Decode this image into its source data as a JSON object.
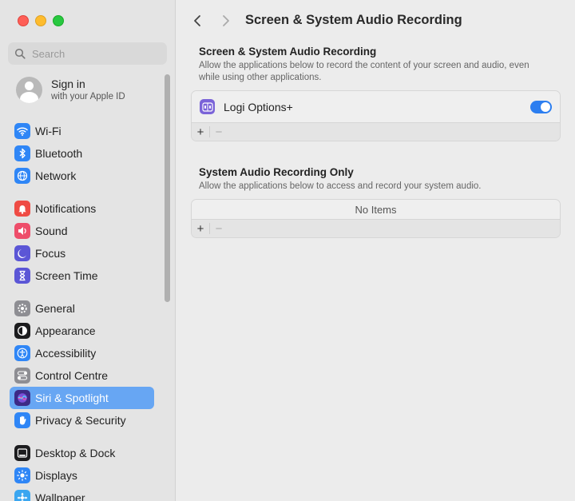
{
  "window": {
    "title": "Screen & System Audio Recording"
  },
  "sidebar": {
    "search_placeholder": "Search",
    "account": {
      "title": "Sign in",
      "subtitle": "with your Apple ID"
    },
    "groups": [
      [
        {
          "label": "Wi-Fi",
          "icon": "wifi-icon",
          "color": "#2f86f6"
        },
        {
          "label": "Bluetooth",
          "icon": "bluetooth-icon",
          "color": "#2f86f6"
        },
        {
          "label": "Network",
          "icon": "globe-icon",
          "color": "#2f86f6"
        }
      ],
      [
        {
          "label": "Notifications",
          "icon": "bell-icon",
          "color": "#ef4b44"
        },
        {
          "label": "Sound",
          "icon": "speaker-icon",
          "color": "#ee4d6a"
        },
        {
          "label": "Focus",
          "icon": "moon-icon",
          "color": "#5b56d6"
        },
        {
          "label": "Screen Time",
          "icon": "hourglass-icon",
          "color": "#5b56d6"
        }
      ],
      [
        {
          "label": "General",
          "icon": "gear-icon",
          "color": "#8e8e93"
        },
        {
          "label": "Appearance",
          "icon": "appearance-icon",
          "color": "#1c1c1e"
        },
        {
          "label": "Accessibility",
          "icon": "accessibility-icon",
          "color": "#2f86f6"
        },
        {
          "label": "Control Centre",
          "icon": "toggles-icon",
          "color": "#8e8e93"
        },
        {
          "label": "Siri & Spotlight",
          "icon": "siri-icon",
          "color": "#3c2a86",
          "active": true
        },
        {
          "label": "Privacy & Security",
          "icon": "hand-icon",
          "color": "#2f86f6"
        }
      ],
      [
        {
          "label": "Desktop & Dock",
          "icon": "dock-icon",
          "color": "#1c1c1e"
        },
        {
          "label": "Displays",
          "icon": "sun-icon",
          "color": "#2f86f6"
        },
        {
          "label": "Wallpaper",
          "icon": "wallpaper-icon",
          "color": "#3aa6f0"
        }
      ]
    ]
  },
  "toolbar": {
    "title": "Screen & System Audio Recording"
  },
  "sections": {
    "screen": {
      "title": "Screen & System Audio Recording",
      "description": "Allow the applications below to record the content of your screen and audio, even while using other applications.",
      "apps": [
        {
          "name": "Logi Options+",
          "enabled": true
        }
      ]
    },
    "audio": {
      "title": "System Audio Recording Only",
      "description": "Allow the applications below to access and record your system audio.",
      "empty_label": "No Items"
    }
  },
  "controls": {
    "add": "+",
    "remove": "−"
  }
}
